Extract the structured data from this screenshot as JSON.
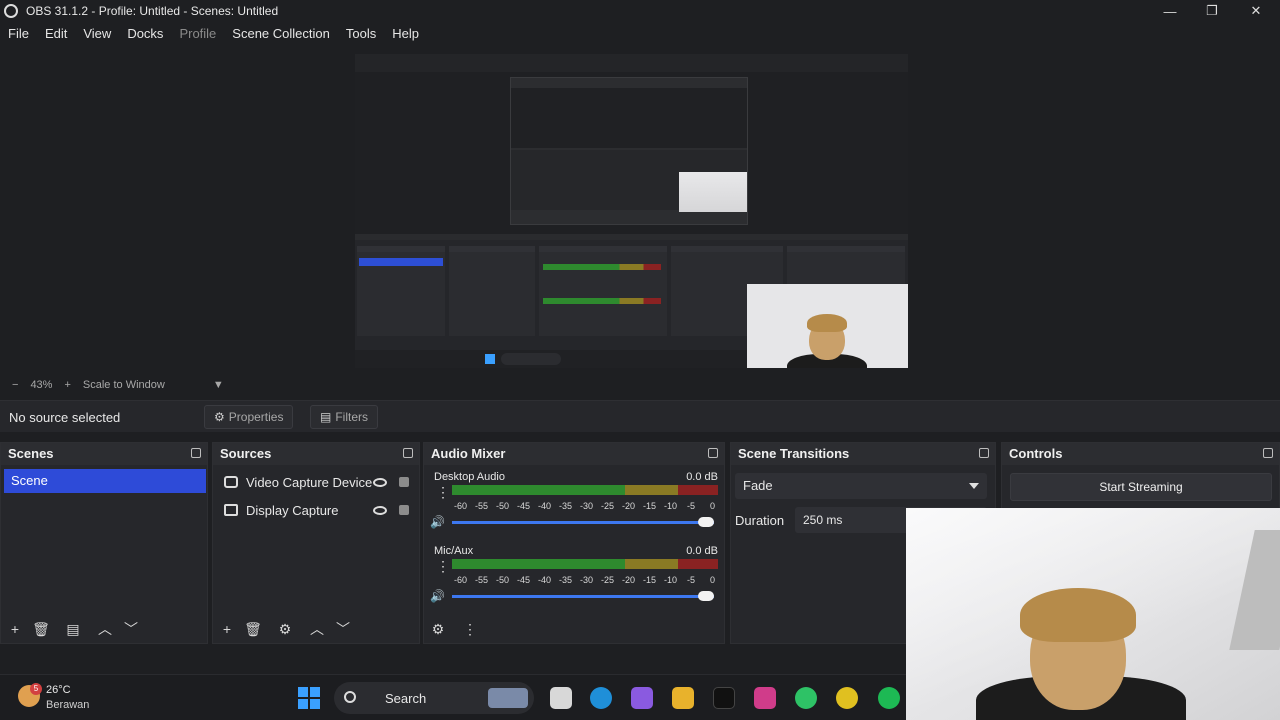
{
  "window": {
    "title": "OBS 31.1.2 - Profile: Untitled - Scenes: Untitled"
  },
  "menu": [
    {
      "label": "File",
      "disabled": false
    },
    {
      "label": "Edit",
      "disabled": false
    },
    {
      "label": "View",
      "disabled": false
    },
    {
      "label": "Docks",
      "disabled": false
    },
    {
      "label": "Profile",
      "disabled": true
    },
    {
      "label": "Scene Collection",
      "disabled": false
    },
    {
      "label": "Tools",
      "disabled": false
    },
    {
      "label": "Help",
      "disabled": false
    }
  ],
  "preview": {
    "zoom": "43%",
    "scale_mode": "Scale to Window"
  },
  "source_toolbar": {
    "status": "No source selected",
    "properties": "Properties",
    "filters": "Filters"
  },
  "scenes": {
    "title": "Scenes",
    "items": [
      "Scene"
    ]
  },
  "sources": {
    "title": "Sources",
    "items": [
      "Video Capture Device",
      "Display Capture"
    ]
  },
  "mixer": {
    "title": "Audio Mixer",
    "channels": [
      {
        "name": "Desktop Audio",
        "db": "0.0 dB"
      },
      {
        "name": "Mic/Aux",
        "db": "0.0 dB"
      }
    ],
    "ticks": [
      "-60",
      "-55",
      "-50",
      "-45",
      "-40",
      "-35",
      "-30",
      "-25",
      "-20",
      "-15",
      "-10",
      "-5",
      "0"
    ]
  },
  "transitions": {
    "title": "Scene Transitions",
    "selected": "Fade",
    "duration_label": "Duration",
    "duration_value": "250 ms"
  },
  "controls": {
    "title": "Controls",
    "start_streaming": "Start Streaming"
  },
  "taskbar": {
    "weather_badge": "5",
    "temperature": "26°C",
    "weather": "Berawan",
    "search": "Search"
  },
  "colors": {
    "accent": "#2e4bd8",
    "background": "#1e1f22",
    "panel": "#26272b"
  }
}
